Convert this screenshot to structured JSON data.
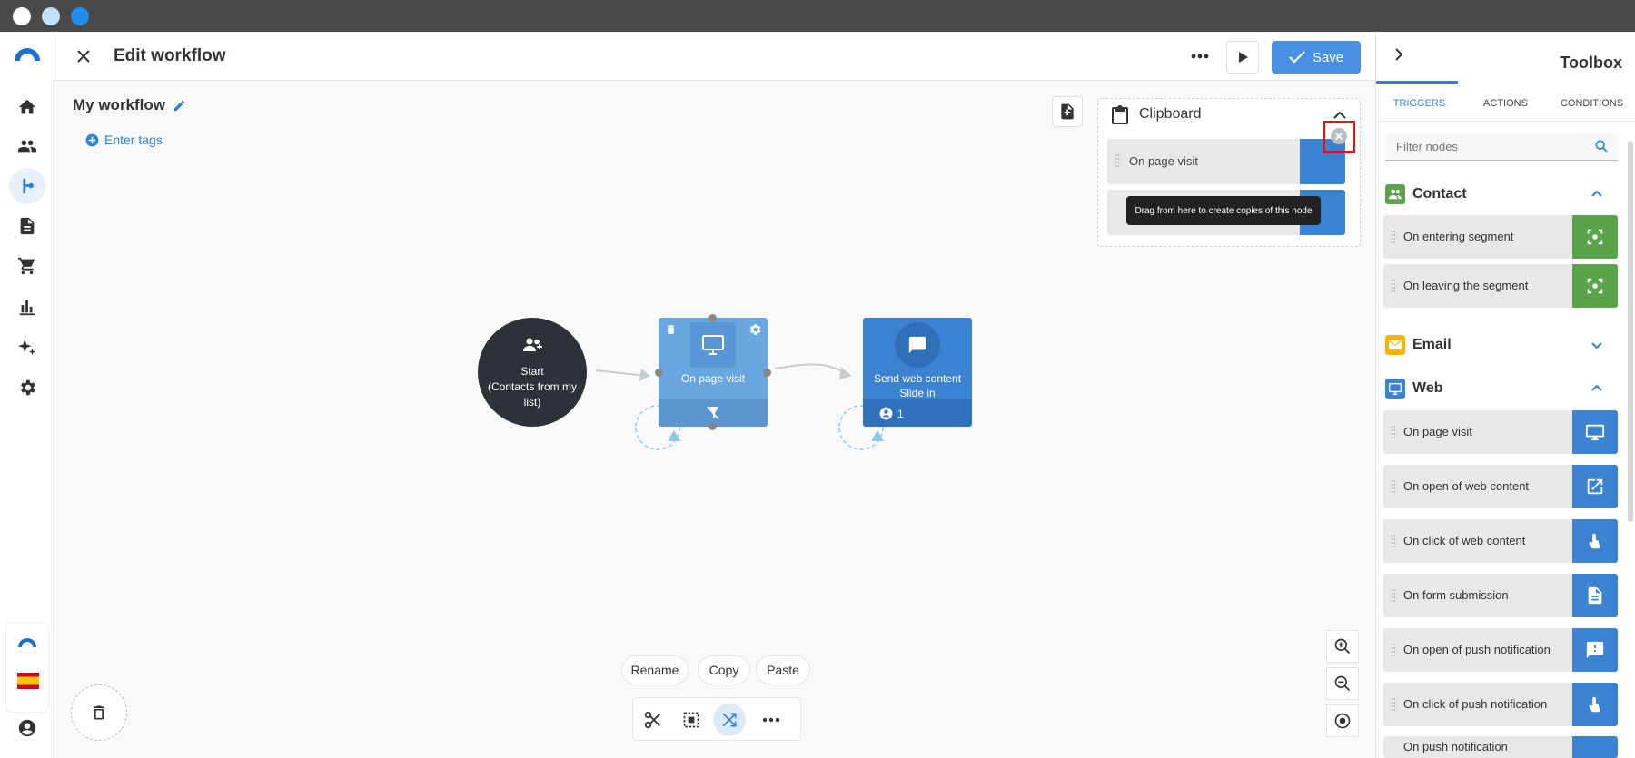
{
  "header": {
    "title": "Edit workflow",
    "save_label": "Save"
  },
  "workflow": {
    "name": "My workflow",
    "tags_label": "Enter tags"
  },
  "clipboard": {
    "title": "Clipboard",
    "items": [
      "On page visit",
      ""
    ],
    "tooltip": "Drag from here to create copies of this node"
  },
  "nodes": {
    "start": {
      "line1": "Start",
      "line2": "(Contacts from my",
      "line3": "list)"
    },
    "n1": {
      "label": "On page visit"
    },
    "n2": {
      "line1": "Send web content",
      "line2": "Slide in",
      "count": "1"
    }
  },
  "floating_actions": [
    "Rename",
    "Copy",
    "Paste"
  ],
  "toolbox": {
    "title": "Toolbox",
    "tabs": [
      "TRIGGERS",
      "ACTIONS",
      "CONDITIONS"
    ],
    "active_tab": "TRIGGERS",
    "filter_placeholder": "Filter nodes",
    "categories": [
      {
        "name": "Contact",
        "color": "#5aa34a",
        "expanded": true,
        "items": [
          "On entering segment",
          "On leaving the segment"
        ]
      },
      {
        "name": "Email",
        "color": "#f5b400",
        "expanded": false,
        "items": []
      },
      {
        "name": "Web",
        "color": "#3b82d0",
        "expanded": true,
        "items": [
          "On page visit",
          "On open of web content",
          "On click of web content",
          "On form submission",
          "On open of push notification",
          "On click of push notification",
          "On push notification"
        ]
      }
    ]
  },
  "colors": {
    "accent": "#4a90e2",
    "contact_green": "#5aa34a",
    "web_blue": "#3b82d0",
    "start_dark": "#2d3238",
    "highlight_red": "#d21a1a"
  }
}
